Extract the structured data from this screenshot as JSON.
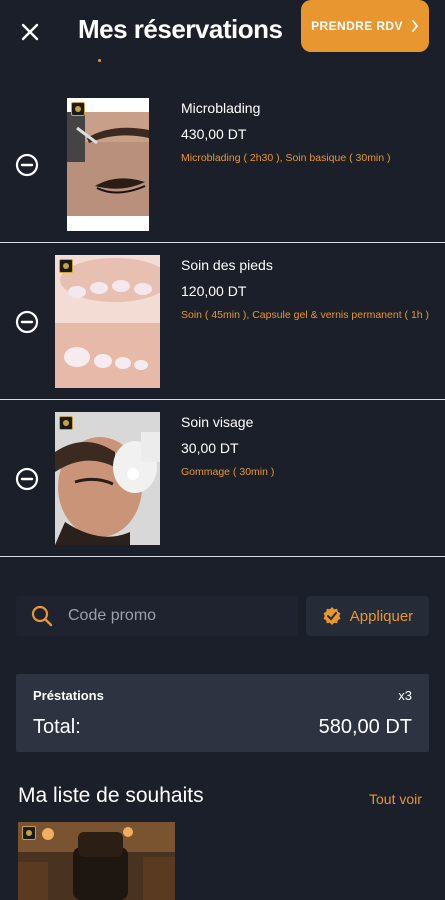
{
  "header": {
    "title": "Mes réservations",
    "cta_label": "PRENDRE RDV"
  },
  "items": [
    {
      "name": "Microblading",
      "price": "430,00 DT",
      "services": "Microblading ( 2h30 ), Soin basique ( 30min )"
    },
    {
      "name": "Soin des pieds",
      "price": "120,00 DT",
      "services": "Soin ( 45min ), Capsule gel & vernis permanent ( 1h )"
    },
    {
      "name": "Soin visage",
      "price": "30,00 DT",
      "services": "Gommage ( 30min )"
    }
  ],
  "promo": {
    "placeholder": "Code promo",
    "apply_label": "Appliquer"
  },
  "summary": {
    "label": "Préstations",
    "count": "x3",
    "total_label": "Total:",
    "total_value": "580,00 DT"
  },
  "wishlist": {
    "title": "Ma liste de souhaits",
    "see_all": "Tout voir"
  },
  "colors": {
    "accent": "#e8962f",
    "background": "#1b1f2a",
    "panel": "#2d3340"
  }
}
